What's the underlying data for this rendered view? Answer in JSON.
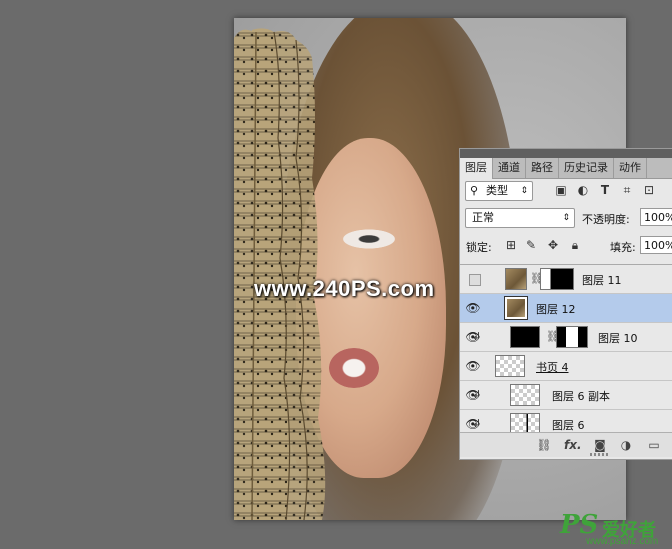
{
  "watermark": "www.240PS.com",
  "logo": {
    "ps": "PS",
    "text": "爱好者",
    "url": "www.psahz.com"
  },
  "layers_panel": {
    "tabs": [
      {
        "label": "图层",
        "active": true
      },
      {
        "label": "通道",
        "active": false
      },
      {
        "label": "路径",
        "active": false
      },
      {
        "label": "历史记录",
        "active": false
      },
      {
        "label": "动作",
        "active": false
      }
    ],
    "filter": {
      "icon": "search-icon",
      "label": "类型",
      "arrow": "⇕"
    },
    "blend_mode": {
      "value": "正常",
      "arrow": "⇕"
    },
    "opacity": {
      "label": "不透明度:",
      "value": "100%"
    },
    "lock": {
      "label": "锁定:"
    },
    "fill": {
      "label": "填充:",
      "value": "100%"
    },
    "layers": [
      {
        "name": "图层 11",
        "visible": false,
        "selected": false
      },
      {
        "name": "图层 12",
        "visible": true,
        "selected": true
      },
      {
        "name": "图层 10",
        "visible": true,
        "selected": false,
        "clipped": true
      },
      {
        "name": "书页 4",
        "visible": true,
        "selected": false,
        "smart_object": true
      },
      {
        "name": "图层 6 副本",
        "visible": true,
        "selected": false,
        "clipped": true
      },
      {
        "name": "图层 6",
        "visible": true,
        "selected": false,
        "clipped": true
      }
    ],
    "footer_icons": [
      "link-icon",
      "fx-icon",
      "mask-icon",
      "adjustment-icon",
      "folder-icon"
    ],
    "footer_fx_label": "fx."
  },
  "colors": {
    "selected_row": "#b4cbeb",
    "logo_green": "#3fa33a",
    "workspace": "#6b6b6b"
  }
}
